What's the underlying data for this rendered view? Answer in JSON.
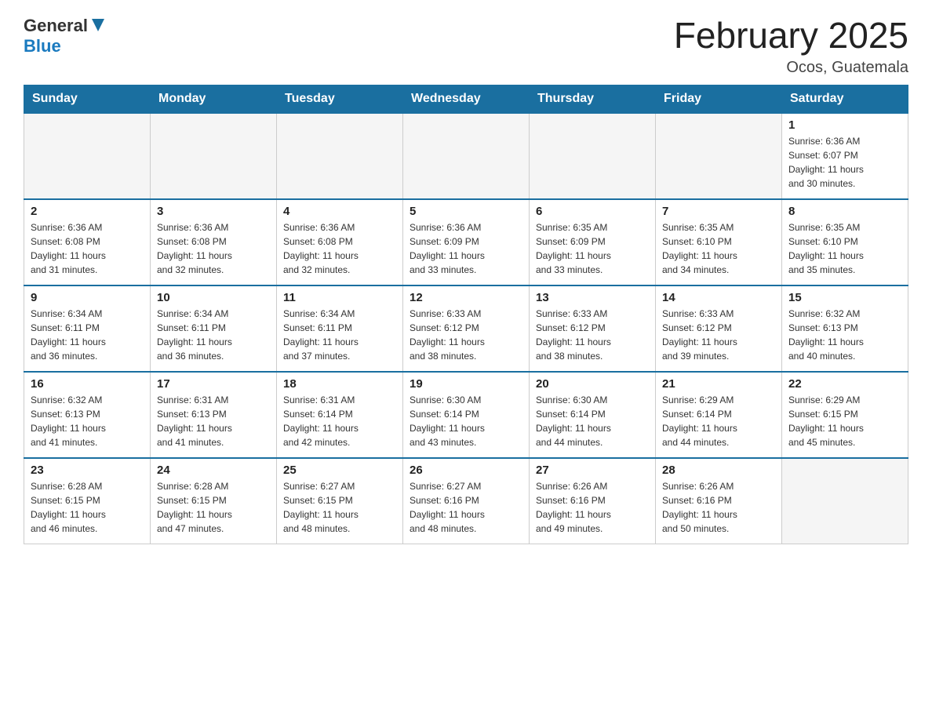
{
  "header": {
    "logo_general": "General",
    "logo_blue": "Blue",
    "title": "February 2025",
    "location": "Ocos, Guatemala"
  },
  "days_of_week": [
    "Sunday",
    "Monday",
    "Tuesday",
    "Wednesday",
    "Thursday",
    "Friday",
    "Saturday"
  ],
  "weeks": [
    [
      {
        "day": "",
        "info": ""
      },
      {
        "day": "",
        "info": ""
      },
      {
        "day": "",
        "info": ""
      },
      {
        "day": "",
        "info": ""
      },
      {
        "day": "",
        "info": ""
      },
      {
        "day": "",
        "info": ""
      },
      {
        "day": "1",
        "info": "Sunrise: 6:36 AM\nSunset: 6:07 PM\nDaylight: 11 hours\nand 30 minutes."
      }
    ],
    [
      {
        "day": "2",
        "info": "Sunrise: 6:36 AM\nSunset: 6:08 PM\nDaylight: 11 hours\nand 31 minutes."
      },
      {
        "day": "3",
        "info": "Sunrise: 6:36 AM\nSunset: 6:08 PM\nDaylight: 11 hours\nand 32 minutes."
      },
      {
        "day": "4",
        "info": "Sunrise: 6:36 AM\nSunset: 6:08 PM\nDaylight: 11 hours\nand 32 minutes."
      },
      {
        "day": "5",
        "info": "Sunrise: 6:36 AM\nSunset: 6:09 PM\nDaylight: 11 hours\nand 33 minutes."
      },
      {
        "day": "6",
        "info": "Sunrise: 6:35 AM\nSunset: 6:09 PM\nDaylight: 11 hours\nand 33 minutes."
      },
      {
        "day": "7",
        "info": "Sunrise: 6:35 AM\nSunset: 6:10 PM\nDaylight: 11 hours\nand 34 minutes."
      },
      {
        "day": "8",
        "info": "Sunrise: 6:35 AM\nSunset: 6:10 PM\nDaylight: 11 hours\nand 35 minutes."
      }
    ],
    [
      {
        "day": "9",
        "info": "Sunrise: 6:34 AM\nSunset: 6:11 PM\nDaylight: 11 hours\nand 36 minutes."
      },
      {
        "day": "10",
        "info": "Sunrise: 6:34 AM\nSunset: 6:11 PM\nDaylight: 11 hours\nand 36 minutes."
      },
      {
        "day": "11",
        "info": "Sunrise: 6:34 AM\nSunset: 6:11 PM\nDaylight: 11 hours\nand 37 minutes."
      },
      {
        "day": "12",
        "info": "Sunrise: 6:33 AM\nSunset: 6:12 PM\nDaylight: 11 hours\nand 38 minutes."
      },
      {
        "day": "13",
        "info": "Sunrise: 6:33 AM\nSunset: 6:12 PM\nDaylight: 11 hours\nand 38 minutes."
      },
      {
        "day": "14",
        "info": "Sunrise: 6:33 AM\nSunset: 6:12 PM\nDaylight: 11 hours\nand 39 minutes."
      },
      {
        "day": "15",
        "info": "Sunrise: 6:32 AM\nSunset: 6:13 PM\nDaylight: 11 hours\nand 40 minutes."
      }
    ],
    [
      {
        "day": "16",
        "info": "Sunrise: 6:32 AM\nSunset: 6:13 PM\nDaylight: 11 hours\nand 41 minutes."
      },
      {
        "day": "17",
        "info": "Sunrise: 6:31 AM\nSunset: 6:13 PM\nDaylight: 11 hours\nand 41 minutes."
      },
      {
        "day": "18",
        "info": "Sunrise: 6:31 AM\nSunset: 6:14 PM\nDaylight: 11 hours\nand 42 minutes."
      },
      {
        "day": "19",
        "info": "Sunrise: 6:30 AM\nSunset: 6:14 PM\nDaylight: 11 hours\nand 43 minutes."
      },
      {
        "day": "20",
        "info": "Sunrise: 6:30 AM\nSunset: 6:14 PM\nDaylight: 11 hours\nand 44 minutes."
      },
      {
        "day": "21",
        "info": "Sunrise: 6:29 AM\nSunset: 6:14 PM\nDaylight: 11 hours\nand 44 minutes."
      },
      {
        "day": "22",
        "info": "Sunrise: 6:29 AM\nSunset: 6:15 PM\nDaylight: 11 hours\nand 45 minutes."
      }
    ],
    [
      {
        "day": "23",
        "info": "Sunrise: 6:28 AM\nSunset: 6:15 PM\nDaylight: 11 hours\nand 46 minutes."
      },
      {
        "day": "24",
        "info": "Sunrise: 6:28 AM\nSunset: 6:15 PM\nDaylight: 11 hours\nand 47 minutes."
      },
      {
        "day": "25",
        "info": "Sunrise: 6:27 AM\nSunset: 6:15 PM\nDaylight: 11 hours\nand 48 minutes."
      },
      {
        "day": "26",
        "info": "Sunrise: 6:27 AM\nSunset: 6:16 PM\nDaylight: 11 hours\nand 48 minutes."
      },
      {
        "day": "27",
        "info": "Sunrise: 6:26 AM\nSunset: 6:16 PM\nDaylight: 11 hours\nand 49 minutes."
      },
      {
        "day": "28",
        "info": "Sunrise: 6:26 AM\nSunset: 6:16 PM\nDaylight: 11 hours\nand 50 minutes."
      },
      {
        "day": "",
        "info": ""
      }
    ]
  ]
}
